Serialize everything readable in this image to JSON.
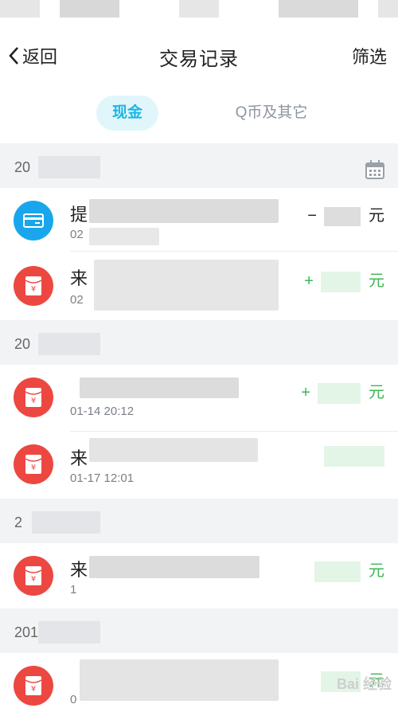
{
  "nav": {
    "back_label": "返回",
    "title": "交易记录",
    "filter_label": "筛选"
  },
  "tabs": {
    "cash": "现金",
    "qcoin": "Q币及其它"
  },
  "sections": [
    {
      "date": "20",
      "rows": [
        {
          "name": "提",
          "time": "02",
          "amount_sign": "−",
          "amount_unit": "元",
          "icon": "card-icon"
        },
        {
          "name": "来",
          "time": "02",
          "amount_sign": "+",
          "amount_unit": "元",
          "icon": "red-packet-icon"
        }
      ]
    },
    {
      "date": "20",
      "rows": [
        {
          "name": "",
          "time": "01-14 20:12",
          "amount_sign": "+",
          "amount_unit": "元",
          "icon": "red-packet-icon"
        },
        {
          "name": "来",
          "time": "01-17 12:01",
          "amount_sign": "",
          "amount_unit": "",
          "icon": "red-packet-icon"
        }
      ]
    },
    {
      "date": "2",
      "rows": [
        {
          "name": "来",
          "time": "1",
          "amount_sign": "",
          "amount_unit": "元",
          "icon": "red-packet-icon"
        }
      ]
    },
    {
      "date": "201",
      "rows": [
        {
          "name": "",
          "time": "0",
          "amount_sign": "",
          "amount_unit": "元",
          "icon": "red-packet-icon"
        }
      ]
    }
  ],
  "watermark": "Bai 经验",
  "colors": {
    "accent": "#1fb6e4",
    "red_packet": "#ec4841",
    "positive": "#3cb655",
    "card_blue": "#1aa6ec"
  },
  "yuan_symbol": "¥"
}
